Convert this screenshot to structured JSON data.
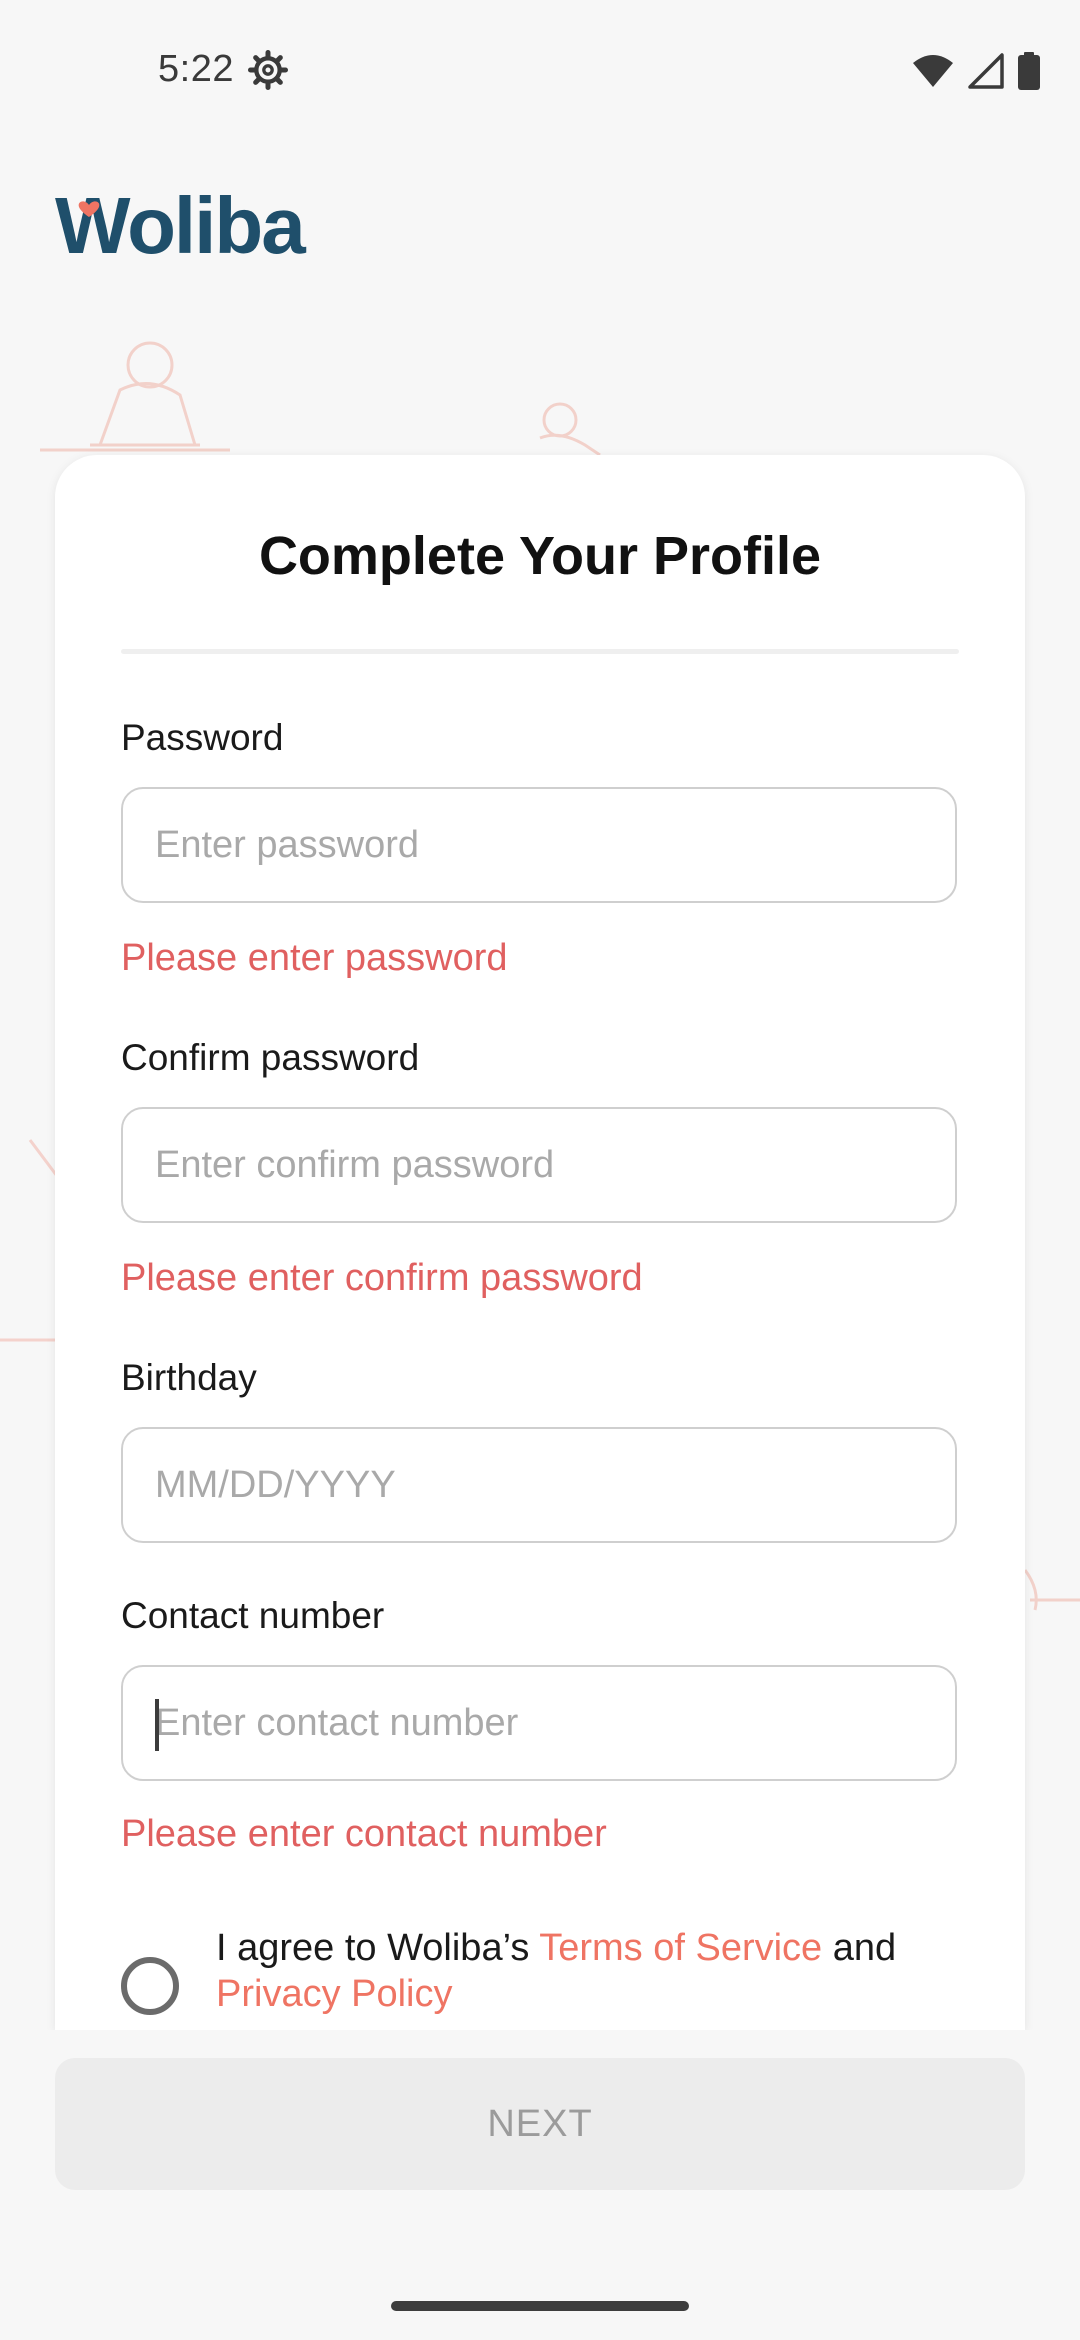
{
  "status_bar": {
    "time": "5:22",
    "icons": [
      "settings-gear-icon",
      "wifi-icon",
      "cellular-signal-icon",
      "battery-icon"
    ]
  },
  "brand": {
    "logo_text": "Woliba",
    "logo_color": "#1f4f6b",
    "accent_color": "#ef7463"
  },
  "form": {
    "title": "Complete Your Profile",
    "password": {
      "label": "Password",
      "placeholder": "Enter password",
      "value": "",
      "error": "Please enter password"
    },
    "confirm_password": {
      "label": "Confirm password",
      "placeholder": "Enter confirm password",
      "value": "",
      "error": "Please enter confirm password"
    },
    "birthday": {
      "label": "Birthday",
      "placeholder": "MM/DD/YYYY",
      "value": ""
    },
    "contact_number": {
      "label": "Contact number",
      "placeholder": "Enter contact number",
      "value": "",
      "error": "Please enter contact number"
    },
    "agreement": {
      "prefix": "I agree to Woliba’s ",
      "terms_link": "Terms of Service",
      "middle": " and",
      "privacy_link": "Privacy Policy",
      "checked": false
    }
  },
  "actions": {
    "next_label": "NEXT"
  },
  "colors": {
    "error": "#e06060",
    "button_disabled_bg": "#ececec",
    "button_disabled_text": "#9b9b9b"
  }
}
